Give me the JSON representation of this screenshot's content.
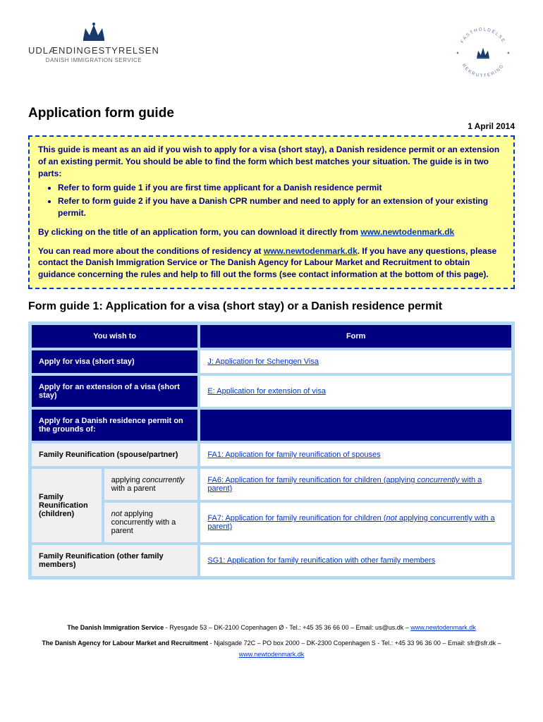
{
  "header": {
    "left_logo_text1": "UDLÆNDINGESTYRELSEN",
    "left_logo_text2": "DANISH IMMIGRATION SERVICE",
    "right_logo_top": "FASTHOLDELSE",
    "right_logo_bottom": "REKRUTTERING"
  },
  "title": "Application form guide",
  "date": "1 April 2014",
  "intro": {
    "p1": "This guide is meant as an aid if you wish to apply for a visa (short stay), a Danish residence permit or an extension of an existing permit. You should be able to find the form which best matches your situation. The guide is in two parts:",
    "b1": "Refer to form guide 1 if you are first time applicant for a Danish residence permit",
    "b2": "Refer to form guide 2 if you have a Danish CPR number and need to apply for an extension of your existing permit.",
    "p2a": "By clicking on the title of an application form, you can download it directly from ",
    "link1": "www.newtodenmark.dk",
    "p3a": "You can read more about the conditions of residency at ",
    "link2": "www.newtodenmark.dk",
    "p3b": ". If you have any questions, please contact the Danish Immigration Service or The Danish Agency for Labour Market and Recruitment to obtain guidance concerning the rules and help to fill out the forms (see contact information at the bottom of this page)."
  },
  "section_title": "Form guide 1: Application for a visa (short stay) or a Danish residence permit",
  "table": {
    "head_left": "You wish to",
    "head_right": "Form",
    "r1_left": "Apply for visa (short stay)",
    "r1_right": "J: Application for Schengen Visa",
    "r2_left": "Apply for an extension of a visa (short stay)",
    "r2_right": "E: Application for extension of visa",
    "r3_left": "Apply for a Danish residence permit on the grounds of:",
    "r4_left": "Family Reunification (spouse/partner)",
    "r4_right": "FA1: Application for family reunification of spouses",
    "r5_label": "Family Reunification (children)",
    "r5a_sub_pre": "applying ",
    "r5a_sub_ital": "concurrently",
    "r5a_sub_post": " with a parent",
    "r5a_right_pre": "FA6: Application for family reunification for children (applying ",
    "r5a_right_ital": "concurrently",
    "r5a_right_post": " with a parent)",
    "r5b_sub_pre": "",
    "r5b_sub_ital": "not",
    "r5b_sub_post": " applying concurrently with a parent",
    "r5b_right_pre": "FA7: Application for family reunification for children (",
    "r5b_right_ital": "not",
    "r5b_right_post": " applying concurrently with a parent)",
    "r6_left": "Family Reunification (other family members)",
    "r6_right": "SG1: Application for family reunification with other family members"
  },
  "footer": {
    "line1_org": "The Danish Immigration Service",
    "line1_rest": " - Ryesgade 53 – DK-2100 Copenhagen Ø - Tel.: +45 35 36 66 00 – Email: us@us.dk  – ",
    "line1_link": "www.newtodenmark.dk",
    "line2_org": "The Danish Agency for Labour Market and Recruitment",
    "line2_rest": "  - Njalsgade 72C – PO box  2000 – DK-2300 Copenhagen S - Tel.: +45 33 96 36 00 – Email: sfr@sfr.dk – ",
    "line2_link": "www.newtodenmark.dk"
  }
}
